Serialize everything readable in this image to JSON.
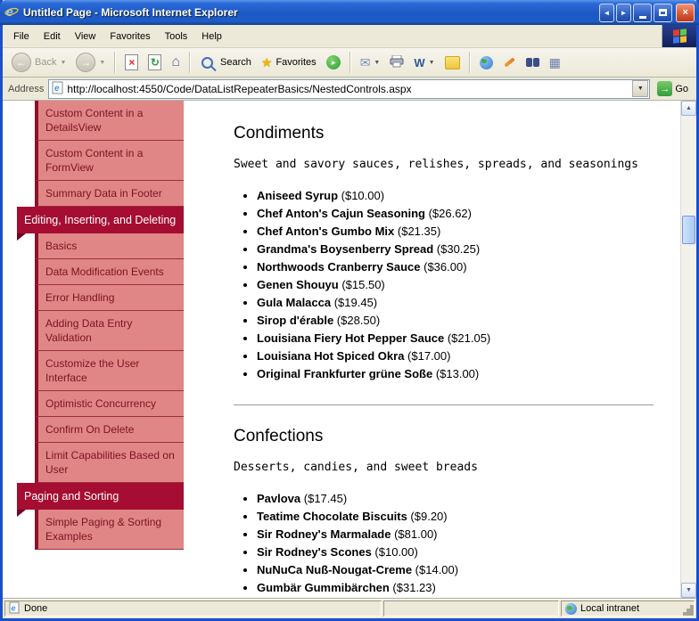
{
  "window": {
    "title": "Untitled Page - Microsoft Internet Explorer",
    "status": {
      "left": "Done",
      "right": "Local intranet"
    }
  },
  "menubar": {
    "items": [
      "File",
      "Edit",
      "View",
      "Favorites",
      "Tools",
      "Help"
    ]
  },
  "toolbar": {
    "back_label": "Back",
    "search_label": "Search",
    "favorites_label": "Favorites",
    "icon_names": [
      "back-icon",
      "forward-icon",
      "stop-icon",
      "refresh-icon",
      "home-icon",
      "search-icon",
      "favorites-star-icon",
      "media-icon",
      "mail-icon",
      "print-icon",
      "edit-with-word-icon",
      "messenger-icon",
      "msn-globe-icon",
      "research-icon",
      "discuss-icon",
      "toolbar-grid-icon"
    ]
  },
  "addressbar": {
    "label": "Address",
    "url": "http://localhost:4550/Code/DataListRepeaterBasics/NestedControls.aspx",
    "go": "Go"
  },
  "glyphs": {
    "back_arrow": "←",
    "forward_arrow": "→",
    "close": "×",
    "stop": "×",
    "refresh": "↻",
    "home": "⌂",
    "star": "★",
    "mail": "✉",
    "word": "W",
    "dropdown": "▼",
    "go_arrow": "→",
    "up_arrow": "▲",
    "down_arrow": "▼",
    "left_arrow": "◄",
    "right_arrow": "►",
    "play": "▸",
    "grid": "▦"
  },
  "colors": {
    "sidebar_header_bg": "#a50d32",
    "sidebar_item_bg": "#e08687",
    "sidebar_item_text": "#7c1322",
    "titlebar_blue": "#1c58c4",
    "go_green": "#2f9e3a"
  },
  "sidebar": {
    "items": [
      {
        "label": "Custom Content in a DetailsView",
        "type": "item"
      },
      {
        "label": "Custom Content in a FormView",
        "type": "item"
      },
      {
        "label": "Summary Data in Footer",
        "type": "item"
      },
      {
        "label": "Editing, Inserting, and Deleting",
        "type": "header"
      },
      {
        "label": "Basics",
        "type": "item"
      },
      {
        "label": "Data Modification Events",
        "type": "item"
      },
      {
        "label": "Error Handling",
        "type": "item"
      },
      {
        "label": "Adding Data Entry Validation",
        "type": "item"
      },
      {
        "label": "Customize the User Interface",
        "type": "item"
      },
      {
        "label": "Optimistic Concurrency",
        "type": "item"
      },
      {
        "label": "Confirm On Delete",
        "type": "item"
      },
      {
        "label": "Limit Capabilities Based on User",
        "type": "item"
      },
      {
        "label": "Paging and Sorting",
        "type": "header"
      },
      {
        "label": "Simple Paging & Sorting Examples",
        "type": "item"
      }
    ]
  },
  "content": {
    "sections": [
      {
        "title": "Condiments",
        "description": "Sweet and savory sauces, relishes, spreads, and seasonings",
        "products": [
          {
            "name": "Aniseed Syrup",
            "price": "($10.00)"
          },
          {
            "name": "Chef Anton's Cajun Seasoning",
            "price": "($26.62)"
          },
          {
            "name": "Chef Anton's Gumbo Mix",
            "price": "($21.35)"
          },
          {
            "name": "Grandma's Boysenberry Spread",
            "price": "($30.25)"
          },
          {
            "name": "Northwoods Cranberry Sauce",
            "price": "($36.00)"
          },
          {
            "name": "Genen Shouyu",
            "price": "($15.50)"
          },
          {
            "name": "Gula Malacca",
            "price": "($19.45)"
          },
          {
            "name": "Sirop d'érable",
            "price": "($28.50)"
          },
          {
            "name": "Louisiana Fiery Hot Pepper Sauce",
            "price": "($21.05)"
          },
          {
            "name": "Louisiana Hot Spiced Okra",
            "price": "($17.00)"
          },
          {
            "name": "Original Frankfurter grüne Soße",
            "price": "($13.00)"
          }
        ]
      },
      {
        "title": "Confections",
        "description": "Desserts, candies, and sweet breads",
        "products": [
          {
            "name": "Pavlova",
            "price": "($17.45)"
          },
          {
            "name": "Teatime Chocolate Biscuits",
            "price": "($9.20)"
          },
          {
            "name": "Sir Rodney's Marmalade",
            "price": "($81.00)"
          },
          {
            "name": "Sir Rodney's Scones",
            "price": "($10.00)"
          },
          {
            "name": "NuNuCa Nuß-Nougat-Creme",
            "price": "($14.00)"
          },
          {
            "name": "Gumbär Gummibärchen",
            "price": "($31.23)"
          }
        ]
      }
    ]
  }
}
